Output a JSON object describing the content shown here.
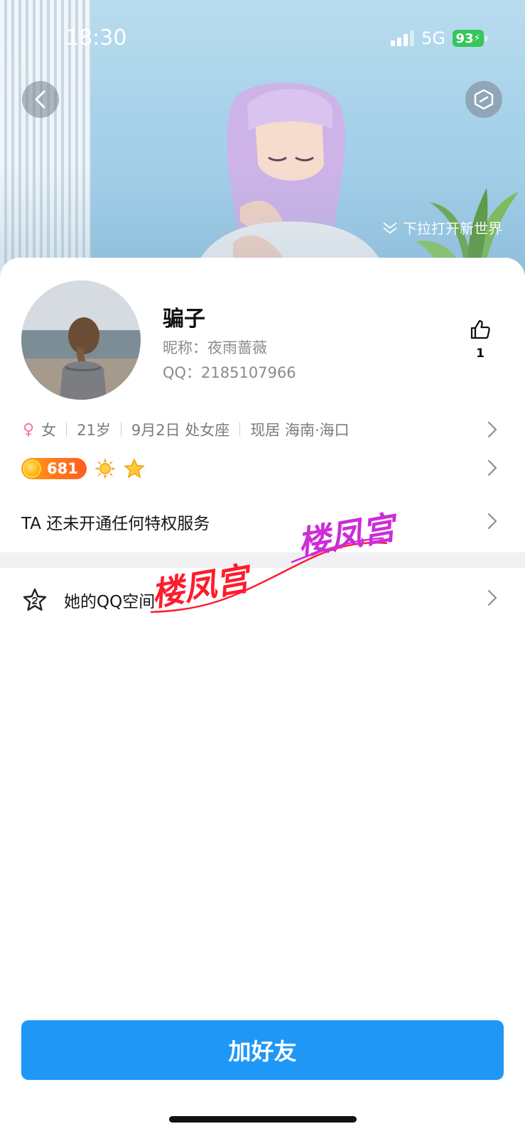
{
  "status_bar": {
    "time": "18:30",
    "network": "5G",
    "battery": "93"
  },
  "hero": {
    "pull_hint": "下拉打开新世界"
  },
  "profile": {
    "name": "骗子",
    "nickname": "昵称：夜雨蔷薇",
    "qq": "QQ：2185107966",
    "likes": "1"
  },
  "info": {
    "gender_icon": "♀",
    "gender": "女",
    "age": "21岁",
    "birthday": "9月2日 处女座",
    "location": "现居 海南·海口"
  },
  "level": {
    "value": "681"
  },
  "privilege": {
    "text": "TA 还未开通任何特权服务"
  },
  "zone": {
    "label": "她的QQ空间"
  },
  "watermarks": [
    "楼凤宫",
    "楼凤宫"
  ],
  "actions": {
    "add_friend": "加好友"
  },
  "colors": {
    "primary": "#1e97f7",
    "battery_green": "#34c759",
    "watermark_red": "#ff1b2d",
    "watermark_purple": "#cc2cd9",
    "gender_pink": "#ff6fa8"
  }
}
